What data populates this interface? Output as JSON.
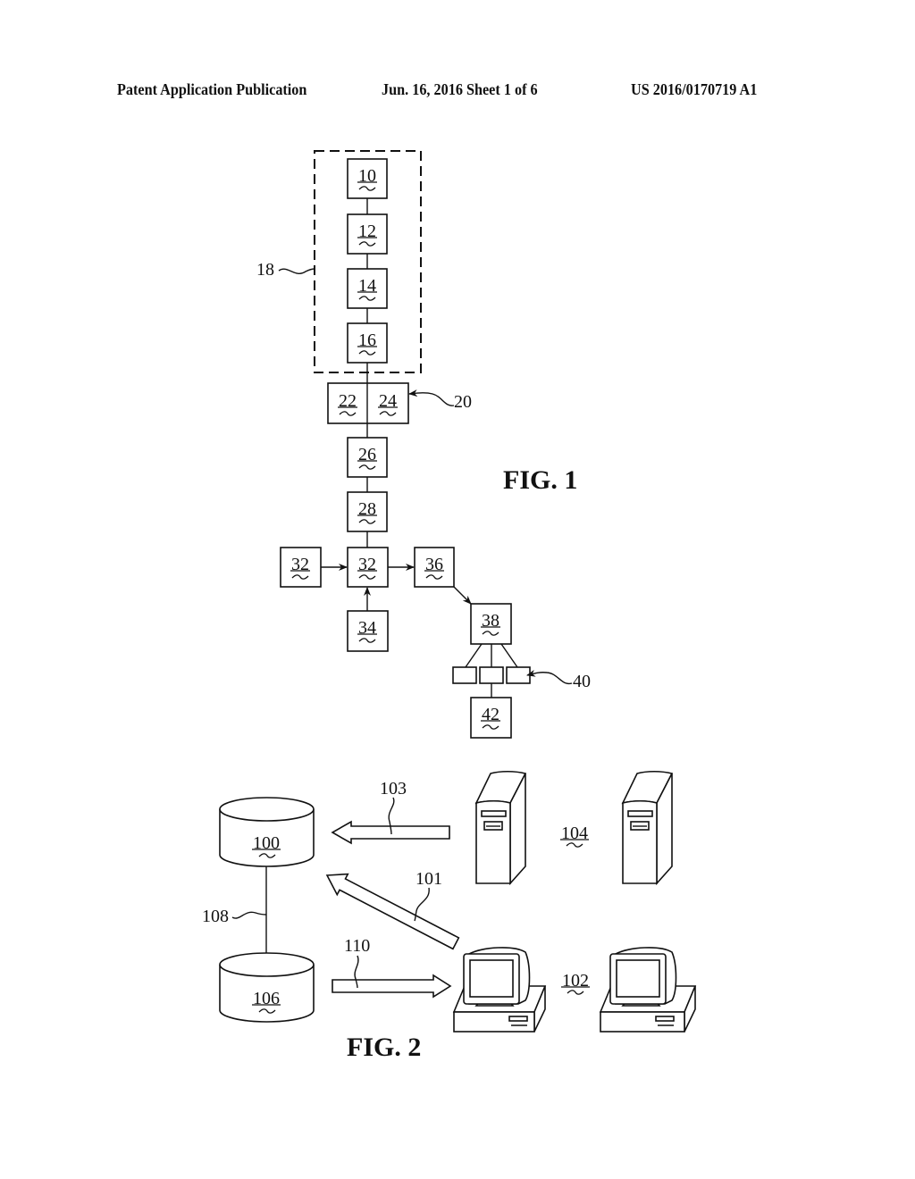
{
  "header": {
    "publication": "Patent Application Publication",
    "date_sheet": "Jun. 16, 2016  Sheet 1 of 6",
    "number": "US 2016/0170719 A1"
  },
  "fig1": {
    "title": "FIG. 1",
    "group_label": "18",
    "split_label": "20",
    "split_left": "22",
    "split_right": "24",
    "boxes": {
      "b10": "10",
      "b12": "12",
      "b14": "14",
      "b16": "16",
      "b26": "26",
      "b28": "28",
      "b32_left": "32",
      "b32_center": "32",
      "b34": "34",
      "b36": "36",
      "b38": "38",
      "b42": "42"
    },
    "small_boxes_label": "40"
  },
  "fig2": {
    "title": "FIG. 2",
    "db_primary": "100",
    "db_secondary": "106",
    "arrow_101": "101",
    "arrow_103": "103",
    "line_108": "108",
    "arrow_110": "110",
    "servers_label": "104",
    "workstations_label": "102"
  }
}
